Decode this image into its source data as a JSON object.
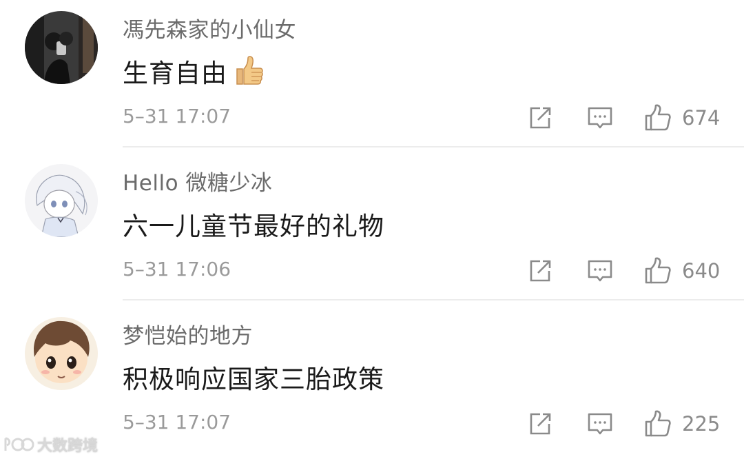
{
  "comments": [
    {
      "username": "馮先森家的小仙女",
      "text": "生育自由",
      "emoji": "thumbs-up-emoji",
      "time": "5–31 17:07",
      "likes": "674"
    },
    {
      "username": "Hello 微糖少冰",
      "text": "六一儿童节最好的礼物",
      "time": "5–31 17:06",
      "likes": "640"
    },
    {
      "username": "梦恺始的地方",
      "text": "积极响应国家三胎政策",
      "time": "5–31 17:07",
      "likes": "225"
    }
  ],
  "icons": {
    "repost": "repost-icon",
    "comment": "comment-icon",
    "like": "thumbs-up-icon"
  },
  "watermark": "大数跨境",
  "colors": {
    "username": "#6b6b6b",
    "text": "#1a1a1a",
    "meta": "#9a9a9a",
    "divider": "#ececec"
  }
}
